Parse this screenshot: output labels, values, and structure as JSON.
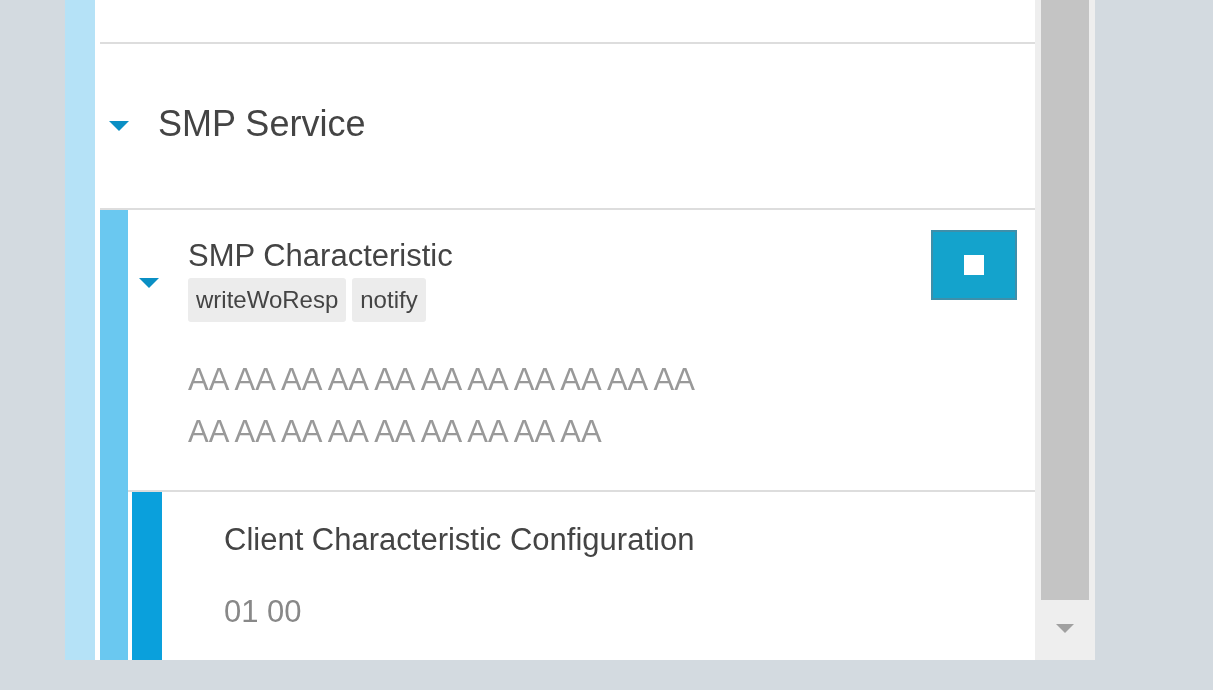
{
  "service": {
    "name": "SMP Service",
    "expanded": true
  },
  "characteristic": {
    "name": "SMP Characteristic",
    "expanded": true,
    "properties": [
      "writeWoResp",
      "notify"
    ],
    "value_lines": [
      "AA AA AA AA AA AA AA AA AA AA AA",
      "AA AA AA AA AA AA AA AA AA"
    ]
  },
  "descriptor": {
    "name": "Client Characteristic Configuration",
    "value": "01 00"
  }
}
